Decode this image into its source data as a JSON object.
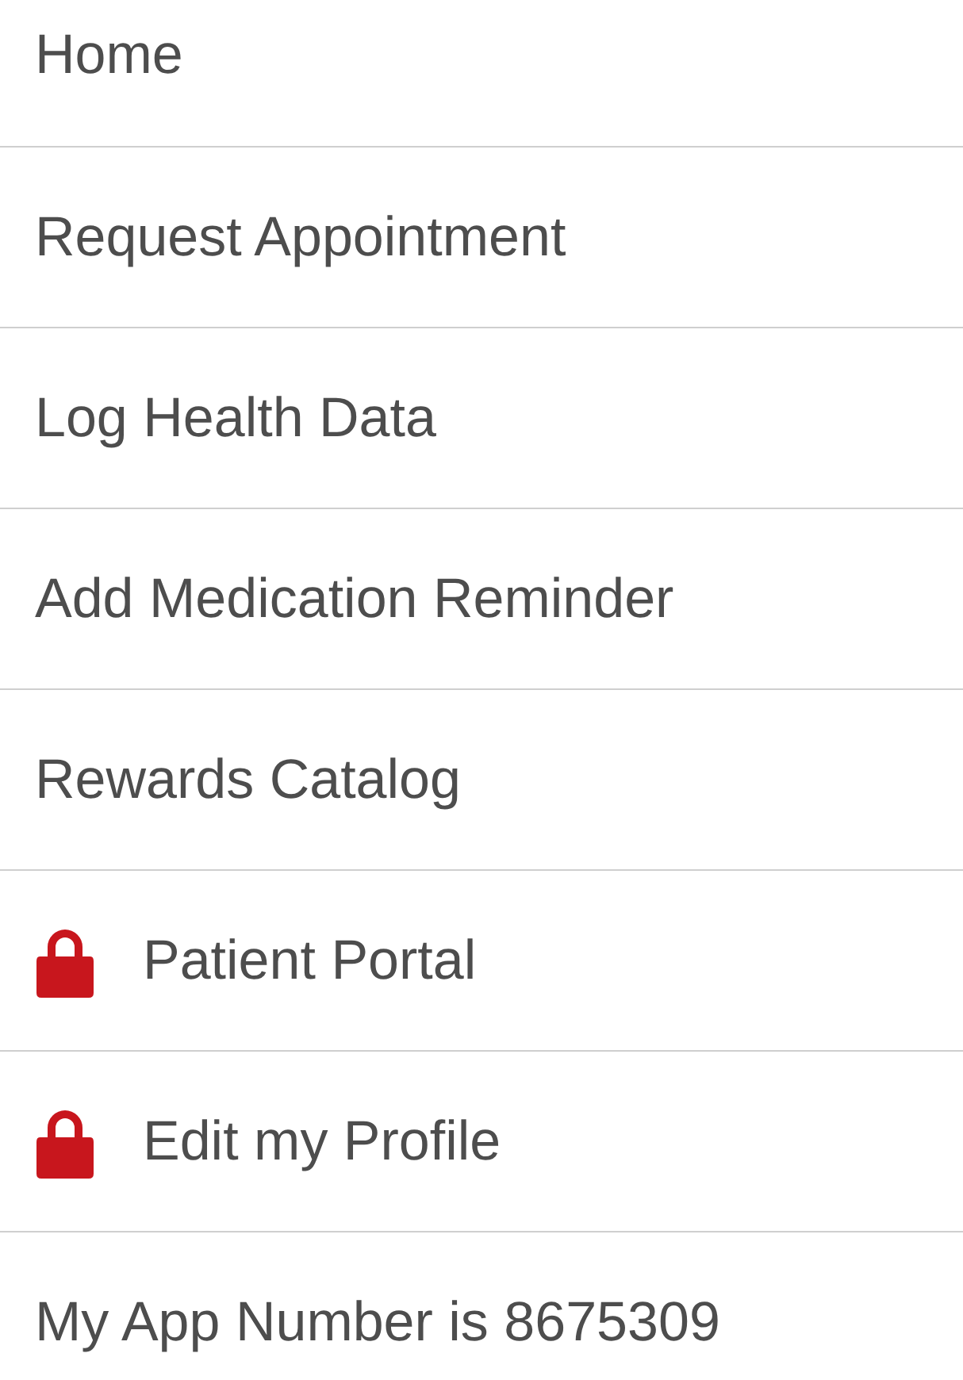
{
  "menu": {
    "items": [
      {
        "label": "Home",
        "locked": false
      },
      {
        "label": "Request Appointment",
        "locked": false
      },
      {
        "label": "Log Health Data",
        "locked": false
      },
      {
        "label": "Add Medication Reminder",
        "locked": false
      },
      {
        "label": "Rewards Catalog",
        "locked": false
      },
      {
        "label": "Patient Portal",
        "locked": true
      },
      {
        "label": "Edit my Profile",
        "locked": true
      },
      {
        "label": "My App Number is 8675309",
        "locked": false
      }
    ]
  }
}
